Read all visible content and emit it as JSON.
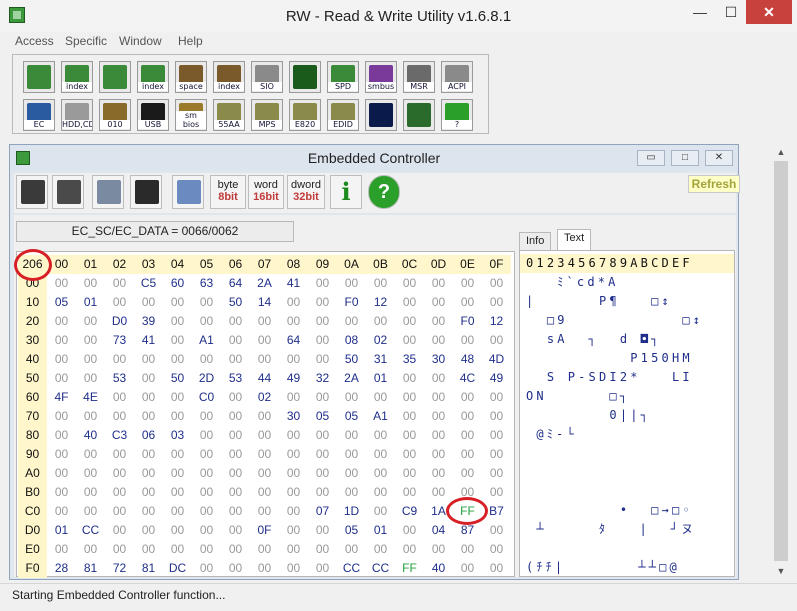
{
  "app": {
    "title": "RW - Read & Write Utility v1.6.8.1",
    "min_glyph": "—",
    "max_glyph": "☐",
    "close_glyph": "✕"
  },
  "menu": [
    "Access",
    "Specific",
    "Window",
    "Help"
  ],
  "toolbar": {
    "row1": [
      {
        "icon": "pci-icon",
        "label": "",
        "color": "#3a8a3a"
      },
      {
        "icon": "pci-index-icon",
        "label": "index",
        "color": "#3a8a3a"
      },
      {
        "icon": "memory-icon",
        "label": "",
        "color": "#3a8a3a"
      },
      {
        "icon": "memory-index-icon",
        "label": "index",
        "color": "#3a8a3a"
      },
      {
        "icon": "io-space-icon",
        "label": "space",
        "color": "#7a5a2a"
      },
      {
        "icon": "io-index-icon",
        "label": "index",
        "color": "#7a5a2a"
      },
      {
        "icon": "super-io-icon",
        "label": "SIO",
        "color": "#8a8a8a"
      },
      {
        "icon": "oscilloscope-icon",
        "label": "",
        "color": "#1a5a1a"
      },
      {
        "icon": "spd-icon",
        "label": "SPD",
        "color": "#3a8a3a"
      },
      {
        "icon": "smbus-icon",
        "label": "smbus",
        "color": "#7a3a9a"
      },
      {
        "icon": "msr-icon",
        "label": "MSR",
        "color": "#6a6a6a"
      },
      {
        "icon": "acpi-icon",
        "label": "ACPI",
        "color": "#8a8a8a"
      }
    ],
    "row2": [
      {
        "icon": "ec-icon",
        "label": "EC",
        "color": "#2a5aa0"
      },
      {
        "icon": "disk-icon",
        "label": "HDD,CD",
        "color": "#9a9a9a"
      },
      {
        "icon": "cmos-icon",
        "label": "010",
        "color": "#8a6a2a"
      },
      {
        "icon": "usb-icon",
        "label": "USB",
        "color": "#1a1a1a"
      },
      {
        "icon": "smbios-icon",
        "label": "sm bios",
        "color": "#9a7a2a"
      },
      {
        "icon": "rom-icon",
        "label": "55AA",
        "color": "#8a8a4a"
      },
      {
        "icon": "mps-icon",
        "label": "MPS",
        "color": "#8a8a4a"
      },
      {
        "icon": "e820-icon",
        "label": "E820",
        "color": "#8a8a4a"
      },
      {
        "icon": "edid-icon",
        "label": "EDID",
        "color": "#8a8a4a"
      },
      {
        "icon": "command-icon",
        "label": "",
        "color": "#0a1a4a"
      },
      {
        "icon": "utilities-icon",
        "label": "",
        "color": "#2a6a2a"
      },
      {
        "icon": "help-icon",
        "label": "?",
        "color": "#2aa02a"
      }
    ]
  },
  "ec_window": {
    "title": "Embedded Controller",
    "min_glyph": "▭",
    "max_glyph": "□",
    "close_glyph": "✕",
    "buttons": {
      "byte": "byte",
      "byte_bit": "8bit",
      "word": "word",
      "word_bit": "16bit",
      "dword": "dword",
      "dword_bit": "32bit",
      "info_glyph": "i",
      "help_glyph": "?"
    },
    "refresh_label": "Refresh",
    "reg_label": "EC_SC/EC_DATA = 0066/0062",
    "corner": "206",
    "col_headers": [
      "00",
      "01",
      "02",
      "03",
      "04",
      "05",
      "06",
      "07",
      "08",
      "09",
      "0A",
      "0B",
      "0C",
      "0D",
      "0E",
      "0F"
    ],
    "rows": [
      {
        "addr": "00",
        "cells": [
          "00",
          "00",
          "00",
          "C5",
          "60",
          "63",
          "64",
          "2A",
          "41",
          "00",
          "00",
          "00",
          "00",
          "00",
          "00",
          "00"
        ]
      },
      {
        "addr": "10",
        "cells": [
          "05",
          "01",
          "00",
          "00",
          "00",
          "00",
          "50",
          "14",
          "00",
          "00",
          "F0",
          "12",
          "00",
          "00",
          "00",
          "00"
        ]
      },
      {
        "addr": "20",
        "cells": [
          "00",
          "00",
          "D0",
          "39",
          "00",
          "00",
          "00",
          "00",
          "00",
          "00",
          "00",
          "00",
          "00",
          "00",
          "F0",
          "12"
        ]
      },
      {
        "addr": "30",
        "cells": [
          "00",
          "00",
          "73",
          "41",
          "00",
          "A1",
          "00",
          "00",
          "64",
          "00",
          "08",
          "02",
          "00",
          "00",
          "00",
          "00"
        ]
      },
      {
        "addr": "40",
        "cells": [
          "00",
          "00",
          "00",
          "00",
          "00",
          "00",
          "00",
          "00",
          "00",
          "00",
          "50",
          "31",
          "35",
          "30",
          "48",
          "4D"
        ]
      },
      {
        "addr": "50",
        "cells": [
          "00",
          "00",
          "53",
          "00",
          "50",
          "2D",
          "53",
          "44",
          "49",
          "32",
          "2A",
          "01",
          "00",
          "00",
          "4C",
          "49"
        ]
      },
      {
        "addr": "60",
        "cells": [
          "4F",
          "4E",
          "00",
          "00",
          "00",
          "C0",
          "00",
          "02",
          "00",
          "00",
          "00",
          "00",
          "00",
          "00",
          "00",
          "00"
        ]
      },
      {
        "addr": "70",
        "cells": [
          "00",
          "00",
          "00",
          "00",
          "00",
          "00",
          "00",
          "00",
          "30",
          "05",
          "05",
          "A1",
          "00",
          "00",
          "00",
          "00"
        ]
      },
      {
        "addr": "80",
        "cells": [
          "00",
          "40",
          "C3",
          "06",
          "03",
          "00",
          "00",
          "00",
          "00",
          "00",
          "00",
          "00",
          "00",
          "00",
          "00",
          "00"
        ]
      },
      {
        "addr": "90",
        "cells": [
          "00",
          "00",
          "00",
          "00",
          "00",
          "00",
          "00",
          "00",
          "00",
          "00",
          "00",
          "00",
          "00",
          "00",
          "00",
          "00"
        ]
      },
      {
        "addr": "A0",
        "cells": [
          "00",
          "00",
          "00",
          "00",
          "00",
          "00",
          "00",
          "00",
          "00",
          "00",
          "00",
          "00",
          "00",
          "00",
          "00",
          "00"
        ]
      },
      {
        "addr": "B0",
        "cells": [
          "00",
          "00",
          "00",
          "00",
          "00",
          "00",
          "00",
          "00",
          "00",
          "00",
          "00",
          "00",
          "00",
          "00",
          "00",
          "00"
        ]
      },
      {
        "addr": "C0",
        "cells": [
          "00",
          "00",
          "00",
          "00",
          "00",
          "00",
          "00",
          "00",
          "00",
          "07",
          "1D",
          "00",
          "C9",
          "1A",
          "FF",
          "B7"
        ]
      },
      {
        "addr": "D0",
        "cells": [
          "01",
          "CC",
          "00",
          "00",
          "00",
          "00",
          "00",
          "0F",
          "00",
          "00",
          "05",
          "01",
          "00",
          "04",
          "87",
          "00"
        ]
      },
      {
        "addr": "E0",
        "cells": [
          "00",
          "00",
          "00",
          "00",
          "00",
          "00",
          "00",
          "00",
          "00",
          "00",
          "00",
          "00",
          "00",
          "00",
          "00",
          "00"
        ]
      },
      {
        "addr": "F0",
        "cells": [
          "28",
          "81",
          "72",
          "81",
          "DC",
          "00",
          "00",
          "00",
          "00",
          "00",
          "CC",
          "CC",
          "FF",
          "40",
          "00",
          "00"
        ]
      }
    ],
    "tabs": [
      "Info",
      "Text"
    ],
    "text_header": "0123456789ABCDEF",
    "text_rows": [
      "   ﾐ`cd*A       ",
      "|      P¶   □↕  ",
      "  □9           □↕",
      "  sA  ┐  d ◘┐   ",
      "          P150HM",
      "  S P-SDI2*   LI",
      "ON      □┐      ",
      "        0||┐    ",
      " @ﾐ-└           ",
      "                ",
      "                ",
      "                ",
      "         •  □→□◦",
      " ┴     ﾀ   |  ┘ヌ",
      "                ",
      "(ﾁﾁ|       ┴┴□@ "
    ]
  },
  "scrollbar": {
    "up_glyph": "▲",
    "down_glyph": "▼"
  },
  "status": "Starting Embedded Controller function...",
  "colors": {
    "highlight_circle": "#d81f26",
    "nonzero": "#1f2e8a",
    "ff_value": "#24a03b",
    "zero": "#999999",
    "header_bg": "#fff6cc"
  }
}
